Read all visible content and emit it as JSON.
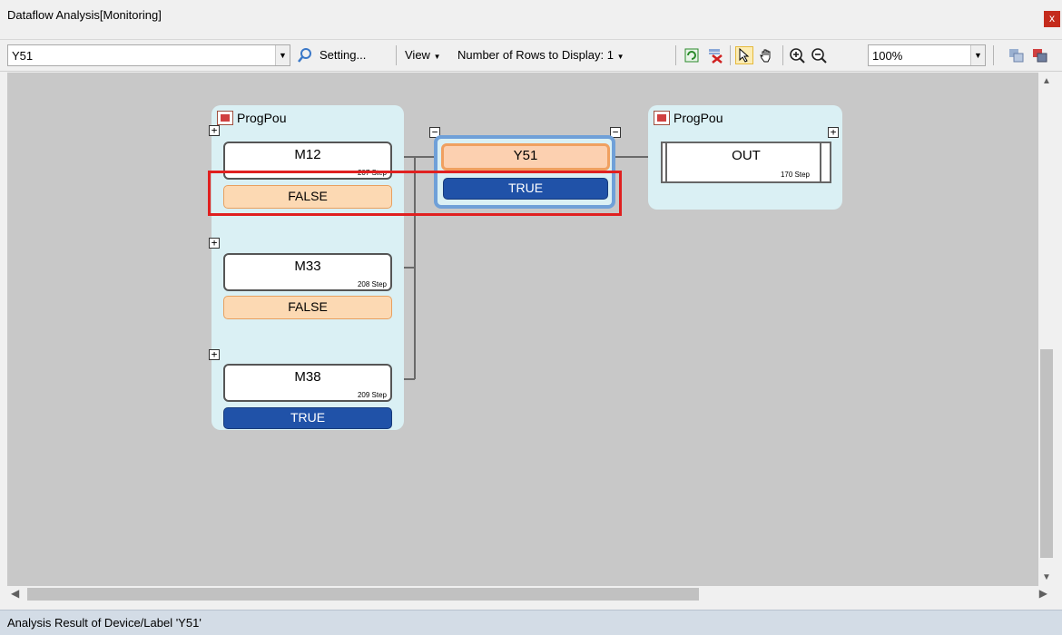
{
  "window": {
    "title": "Dataflow Analysis[Monitoring]",
    "close_glyph": "x"
  },
  "toolbar": {
    "device_value": "Y51",
    "setting_label": "Setting...",
    "view_label": "View",
    "rows_label": "Number of Rows to Display: 1",
    "zoom_value": "100%",
    "icons": [
      "search-icon",
      "refresh-icon",
      "clear-icon",
      "pointer-icon",
      "hand-icon",
      "zoom-in-icon",
      "zoom-out-icon",
      "export-icon",
      "print-icon"
    ]
  },
  "diagram": {
    "input_group": {
      "title": "ProgPou",
      "nodes": [
        {
          "device": "M12",
          "step": "207 Step",
          "value": "FALSE"
        },
        {
          "device": "M33",
          "step": "208 Step",
          "value": "FALSE"
        },
        {
          "device": "M38",
          "step": "209 Step",
          "value": "TRUE"
        }
      ]
    },
    "target": {
      "device": "Y51",
      "value": "TRUE"
    },
    "output_group": {
      "title": "ProgPou",
      "node": {
        "instruction": "OUT",
        "step": "170 Step"
      }
    },
    "colors": {
      "canvas": "#c8c8c8",
      "group_bg": "#daf0f4",
      "false_bg": "#fcd9b3",
      "true_bg": "#2052a8",
      "highlight": "#e02020",
      "target_frame": "#6fa0d8"
    }
  },
  "status": {
    "text": "Analysis Result of Device/Label 'Y51'"
  }
}
